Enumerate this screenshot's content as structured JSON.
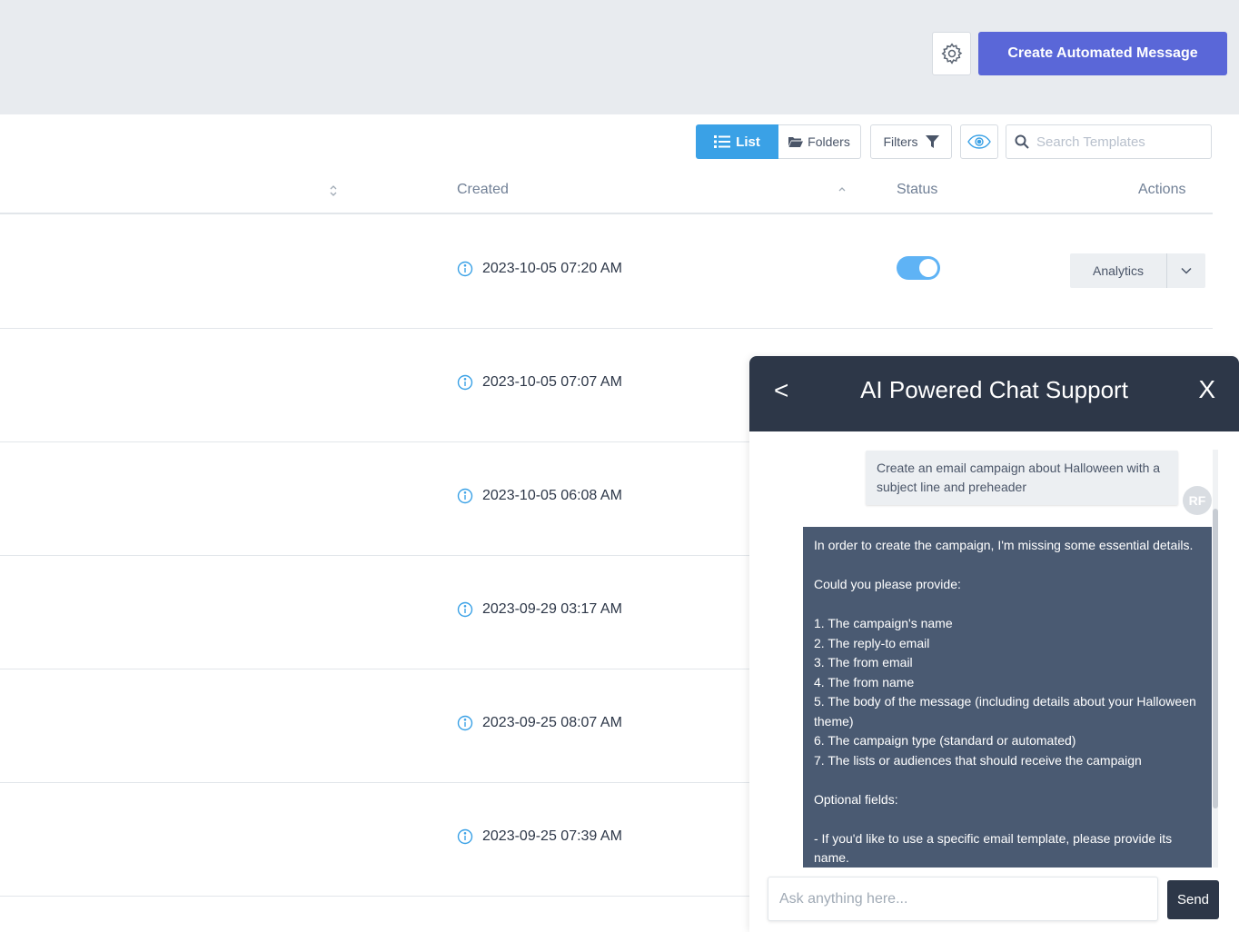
{
  "header": {
    "create_button_label": "Create Automated Message"
  },
  "toolbar": {
    "list_label": "List",
    "folders_label": "Folders",
    "filters_label": "Filters",
    "search_placeholder": "Search Templates"
  },
  "table": {
    "columns": {
      "created": "Created",
      "status": "Status",
      "actions": "Actions"
    },
    "rows": [
      {
        "created": "2023-10-05 07:20 AM",
        "status_on": true,
        "action_label": "Analytics"
      },
      {
        "created": "2023-10-05 07:07 AM"
      },
      {
        "created": "2023-10-05 06:08 AM"
      },
      {
        "created": "2023-09-29 03:17 AM"
      },
      {
        "created": "2023-09-25 08:07 AM"
      },
      {
        "created": "2023-09-25 07:39 AM"
      }
    ]
  },
  "chat": {
    "back_label": "<",
    "title": "AI Powered Chat Support",
    "close_label": "X",
    "user_message": "Create an email campaign about Halloween with a subject line and preheader",
    "user_initials": "RF",
    "bot_message": "In order to create the campaign, I'm missing some essential details.\n\nCould you please provide:\n\n1. The campaign's name\n2. The reply-to email\n3. The from email\n4. The from name\n5. The body of the message (including details about your Halloween theme)\n6. The campaign type (standard or automated)\n7. The lists or audiences that should receive the campaign\n\nOptional fields:\n\n- If you'd like to use a specific email template, please provide its name.",
    "input_placeholder": "Ask anything here...",
    "send_label": "Send"
  },
  "colors": {
    "primary": "#5a67d8",
    "list_active": "#3aa1e6",
    "toggle_on": "#5fb3f5",
    "chat_header": "#2d3748",
    "bot_bubble": "#4a5a72"
  }
}
